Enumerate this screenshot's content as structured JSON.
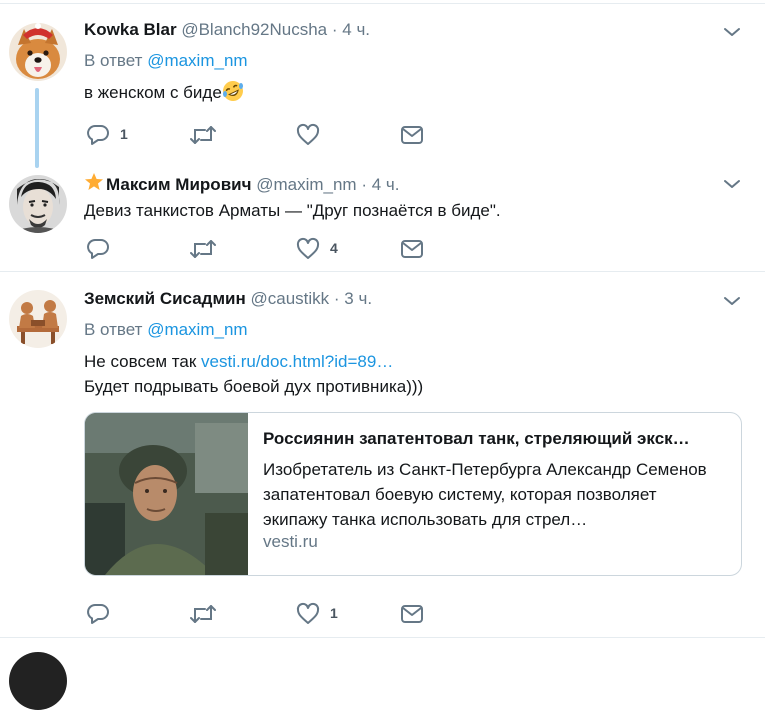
{
  "tweets": [
    {
      "name": "Kowka Blar",
      "handle": "@Blanch92Nucsha",
      "time": "4 ч.",
      "reply_prefix": "В ответ",
      "reply_mention": "@maxim_nm",
      "text": "в женском с биде",
      "emoji": "rolling-on-floor-laughing",
      "replies": "1",
      "retweets": "",
      "likes": ""
    },
    {
      "name": "Максим Мирович",
      "handle": "@maxim_nm",
      "time": "4 ч.",
      "badge": "star-icon",
      "text": "Девиз танкистов Арматы — \"Друг познаётся в биде\".",
      "replies": "",
      "retweets": "",
      "likes": "4"
    },
    {
      "name": "Земский Сисадмин",
      "handle": "@caustikk",
      "time": "3 ч.",
      "reply_prefix": "В ответ",
      "reply_mention": "@maxim_nm",
      "text_line1_prefix": "Не совсем так ",
      "text_line1_link": "vesti.ru/doc.html?id=89…",
      "text_line2": "Будет подрывать боевой дух противника)))",
      "card": {
        "title": "Россиянин запатентовал танк, стреляющий экск…",
        "description": "Изобретатель из Санкт-Петербурга Александр Семенов запатентовал боевую систему, которая позволяет экипажу танка использовать для стрел…",
        "domain": "vesti.ru"
      },
      "replies": "",
      "retweets": "",
      "likes": "1"
    }
  ],
  "dot": "·",
  "colors": {
    "link": "#1b95e0",
    "muted": "#657786",
    "thread_line": "#a9d3f0",
    "divider": "#e6ecf0"
  }
}
